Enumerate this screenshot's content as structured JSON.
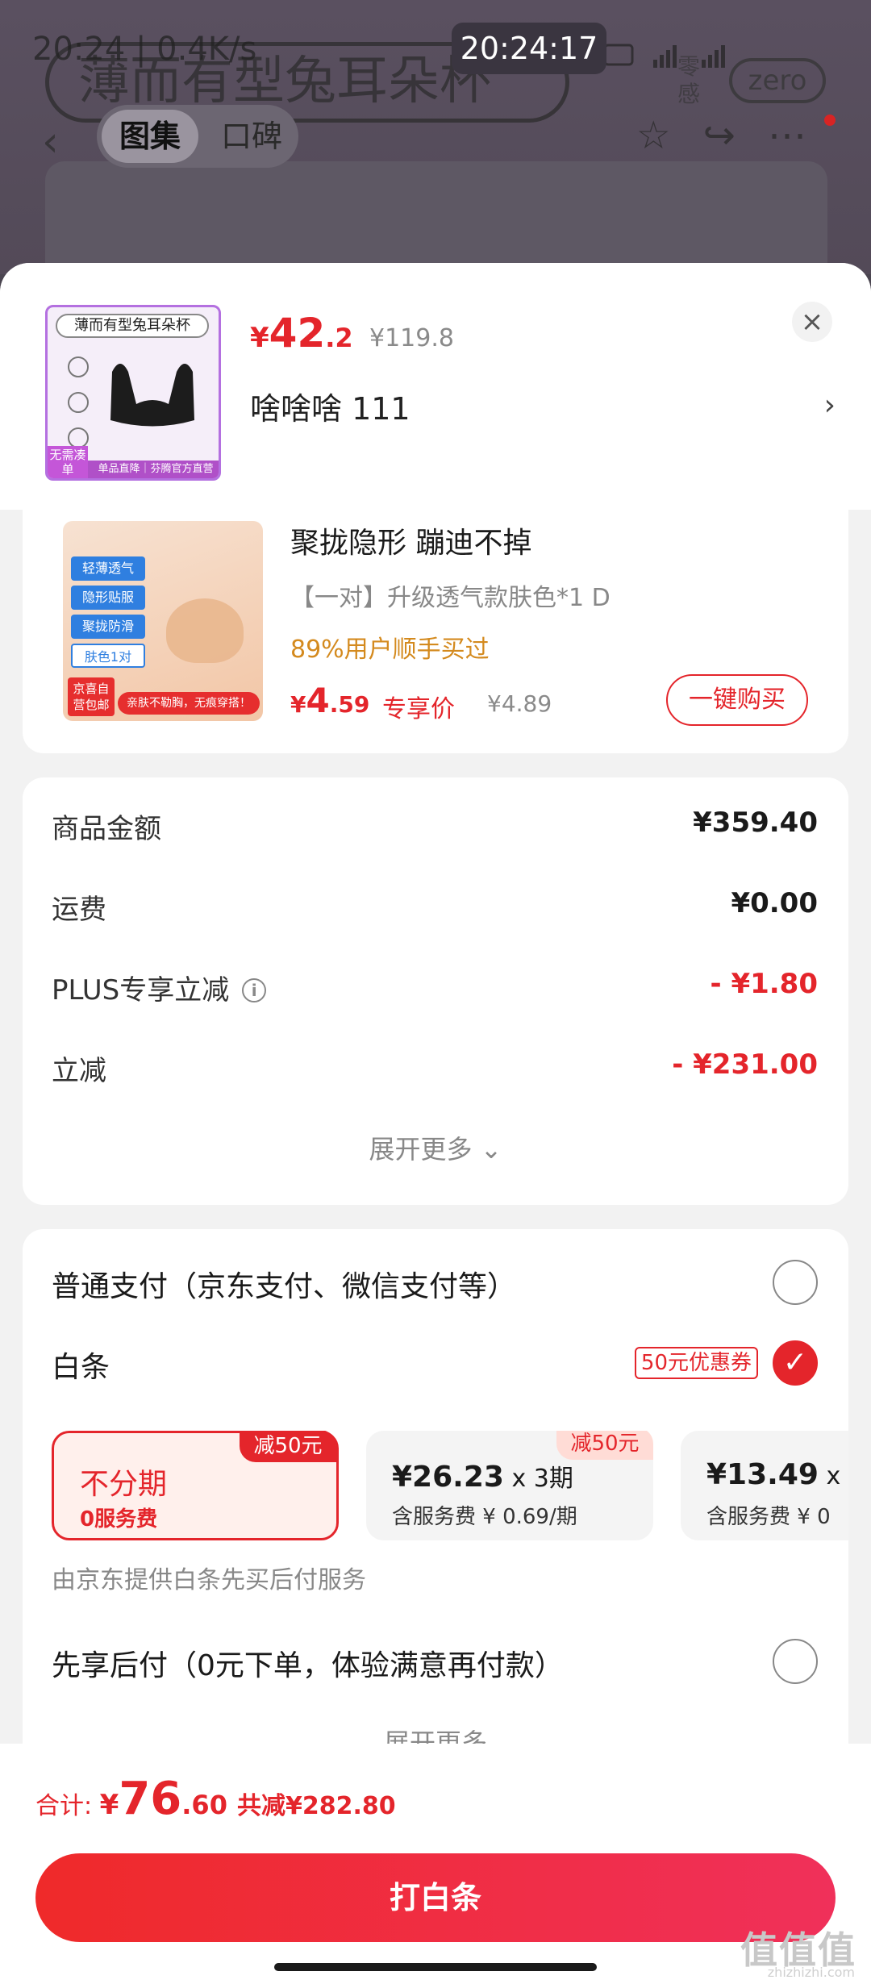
{
  "background": {
    "status_left": "20:24 | 0.4K/s",
    "clock": "20:24:17",
    "banner_text": "薄而有型兔耳朵杯",
    "feel_text": "零感",
    "zero_badge": "zero",
    "tabs": [
      "图集",
      "口碑"
    ]
  },
  "product": {
    "thumb_title": "薄而有型兔耳朵杯",
    "thumb_badge": "无需凑单",
    "thumb_footer": "单品直降｜芬腾官方直营",
    "price_symbol": "¥",
    "price_int": "42",
    "price_dec": ".2",
    "original_price": "¥119.8",
    "sku": "啥啥啥  111"
  },
  "recommend": {
    "img_tags": [
      "轻薄透气",
      "隐形贴服",
      "聚拢防滑",
      "肤色1对"
    ],
    "img_badge": "京喜自营包邮",
    "img_slogan": "亲肤不勒胸，无痕穿搭！",
    "title": "聚拢隐形 蹦迪不掉",
    "spec": "【一对】升级透气款肤色*1   D",
    "hot": "89%用户顺手买过",
    "price_symbol": "¥",
    "price_int": "4",
    "price_dec": ".59",
    "exclusive": "专享价",
    "old_price": "¥4.89",
    "buy_label": "一键购买"
  },
  "summary": {
    "rows": [
      {
        "label": "商品金额",
        "value": "¥359.40"
      },
      {
        "label": "运费",
        "value": "¥0.00"
      },
      {
        "label": "PLUS专享立减",
        "value": "- ¥1.80"
      },
      {
        "label": "立减",
        "value": "- ¥231.00"
      }
    ],
    "expand_label": "展开更多 ⌄"
  },
  "payment": {
    "normal": "普通支付（京东支付、微信支付等）",
    "baitiao": "白条",
    "coupon": "50元优惠券",
    "plans": [
      {
        "tag": "减50元",
        "main": "不分期",
        "sub": "0服务费"
      },
      {
        "tag": "减50元",
        "main_amount": "¥26.23",
        "main_term": " x 3期",
        "sub": "含服务费 ¥ 0.69/期"
      },
      {
        "main_amount": "¥13.49",
        "main_term": " x",
        "sub": "含服务费 ¥ 0"
      }
    ],
    "provider_note": "由京东提供白条先买后付服务",
    "later": "先享后付（0元下单，体验满意再付款）",
    "expand_label": "展开更多"
  },
  "bottom": {
    "total_label": "合计: ",
    "total_symbol": "¥",
    "total_int": "76",
    "total_dec": ".60",
    "discount": "共减¥282.80",
    "pay_label": "打白条"
  },
  "watermark": {
    "text": "值值值",
    "url": "zhizhizhi.com"
  },
  "colors": {
    "accent": "#e4252b",
    "hot": "#d48a1e",
    "muted": "#888888"
  }
}
